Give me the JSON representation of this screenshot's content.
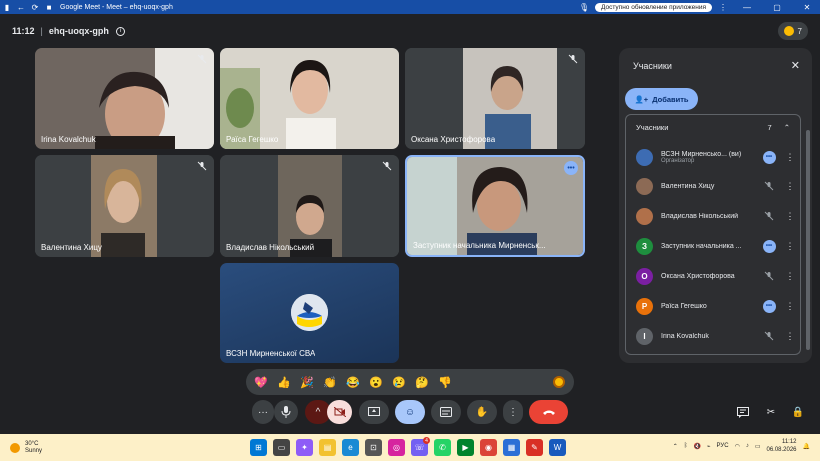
{
  "titlebar": {
    "tab_title": "Google Meet - Meet – ehq-uoqx-gph",
    "update_label": "Доступно обновление приложения"
  },
  "header": {
    "time": "11:12",
    "separator": "|",
    "meeting_code": "ehq-uoqx-gph",
    "participant_count": "7"
  },
  "tiles": [
    {
      "name": "Irina Kovalchuk",
      "mic_off": true,
      "bg": "#6f6660"
    },
    {
      "name": "Раїса Гегешко",
      "mic_off": false,
      "bg": "#cfcac2"
    },
    {
      "name": "Оксана Христофорова",
      "mic_off": true,
      "bg": "#7d7a78"
    },
    {
      "name": "Валентина Хицу",
      "mic_off": true,
      "bg": "#8c7a66"
    },
    {
      "name": "Владислав Нікольський",
      "mic_off": true,
      "bg": "#5d5750"
    },
    {
      "name": "Заступник начальника Мирненськ...",
      "mic_off": false,
      "bg": "#a6a29a"
    },
    {
      "name": "ВСЗН Мирненської СВА",
      "mic_off": false,
      "bg": "#1f3f6b"
    }
  ],
  "panel": {
    "title": "Учасники",
    "add_label": "Добавить",
    "section_label": "Учасники",
    "section_count": "7",
    "participants": [
      {
        "name": "ВСЗН Мирненсько... (ви)",
        "role": "Організатор",
        "initial": "",
        "color": "#3d6cb3",
        "status": "dots"
      },
      {
        "name": "Валентина Хицу",
        "role": "",
        "initial": "",
        "color": "#8c6a55",
        "status": "mic-off"
      },
      {
        "name": "Владислав Нікольський",
        "role": "",
        "initial": "",
        "color": "#b0704a",
        "status": "mic-off"
      },
      {
        "name": "Заступник начальника ...",
        "role": "",
        "initial": "З",
        "color": "#1e8e3e",
        "status": "dots"
      },
      {
        "name": "Оксана Христофорова",
        "role": "",
        "initial": "О",
        "color": "#7b1fa2",
        "status": "mic-off"
      },
      {
        "name": "Раїса Гегешко",
        "role": "",
        "initial": "Р",
        "color": "#e8710a",
        "status": "dots"
      },
      {
        "name": "Irina Kovalchuk",
        "role": "",
        "initial": "I",
        "color": "#5f6368",
        "status": "mic-off"
      }
    ]
  },
  "reactions": [
    "💖",
    "👍",
    "🎉",
    "👏",
    "😂",
    "😮",
    "😢",
    "🤔",
    "👎"
  ],
  "taskbar": {
    "temperature": "30°C",
    "condition": "Sunny",
    "language": "РУС",
    "time": "11:12",
    "date": "06.08.2026",
    "notification_count": "4"
  }
}
